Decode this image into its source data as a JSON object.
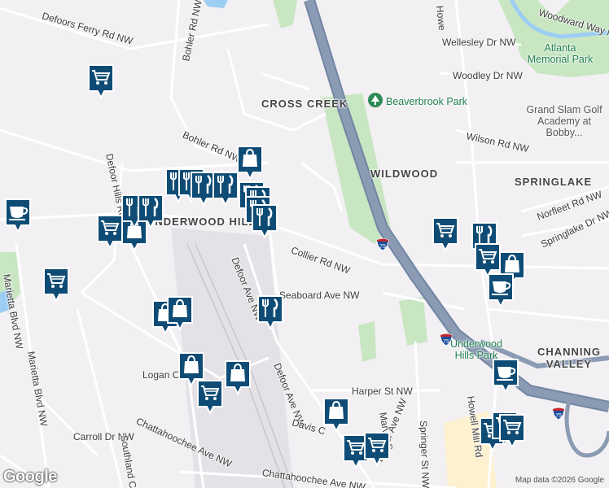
{
  "map": {
    "neighborhoods": {
      "cross_creek": "CROSS CREEK",
      "wildwood": "WILDWOOD",
      "springlake": "SPRINGLAKE",
      "underwood_hills": "UNDERWOOD HILLS",
      "channing_valley": "CHANNING VALLEY"
    },
    "roads": {
      "defoors_ferry": "Defoors Ferry Rd NW",
      "bohler_1": "Bohler Rd NW",
      "bohler_2": "Bohler Rd NW",
      "defoor_hills": "Defoor Hills Rd",
      "defoor_ave_1": "Defoor Ave NW",
      "defoor_ave_2": "Defoor Ave NW",
      "defoor_ave_3": "Defoor Ave NW",
      "collier": "Collier Rd NW",
      "seaboard": "Seaboard Ave NW",
      "marietta_1": "Marietta Blvd NW",
      "marietta_2": "Marietta Blvd NW",
      "logan": "Logan Ci",
      "carroll": "Carroll Dr NW",
      "southland": "Southland C",
      "chattahoochee_1": "Chattahoochee Ave NW",
      "chattahoochee_2": "Chattahoochee Ave NW",
      "davis": "Davis C",
      "harper": "Harper St NW",
      "marvin": "Marvin S",
      "springer": "Springer St NW",
      "howell_mill_top": "Howe",
      "howell_mill_bottom": "Howell Mill Rd",
      "woodward_way": "Woodward Way NW",
      "wellesley": "Wellesley Dr NW",
      "woodley": "Woodley Dr NW",
      "wilson": "Wilson Rd NW",
      "norfleet": "Norfleet Rd NW",
      "springlake_dr": "Springlake Dr NW"
    },
    "parks": {
      "atlanta_memorial": "Atlanta\nMemorial Park",
      "beaverbrook": "Beaverbrook Park",
      "underwood_hills_park": "Underwood\nHills Park"
    },
    "pois": {
      "grand_slam": "Grand Slam Golf\nAcademy at Bobby..."
    },
    "highway": {
      "interstate": "75"
    },
    "credit": "Map data ©2026 Google",
    "logo": "Google",
    "colors": {
      "road": "#ffffff",
      "highway": "#8b9bb4",
      "highway_edge": "#7285a3",
      "park": "#c8e6c2",
      "water": "#9ccdf3",
      "industrial": "#e4e2e6",
      "marker": "#0f4c75",
      "commercial": "#fdf1d0"
    },
    "markers": [
      {
        "kind": "cart"
      },
      {
        "kind": "coffee"
      },
      {
        "kind": "cart"
      },
      {
        "kind": "bag"
      },
      {
        "kind": "cutlery"
      },
      {
        "kind": "cutlery"
      },
      {
        "kind": "cutlery"
      },
      {
        "kind": "cutlery"
      },
      {
        "kind": "cutlery"
      },
      {
        "kind": "cutlery"
      },
      {
        "kind": "cart"
      },
      {
        "kind": "bag"
      },
      {
        "kind": "cutlery"
      },
      {
        "kind": "cutlery"
      },
      {
        "kind": "cutlery"
      },
      {
        "kind": "cutlery"
      },
      {
        "kind": "bag"
      },
      {
        "kind": "bag"
      },
      {
        "kind": "cutlery"
      },
      {
        "kind": "bag"
      },
      {
        "kind": "bag"
      },
      {
        "kind": "cart"
      },
      {
        "kind": "bag"
      },
      {
        "kind": "cart"
      },
      {
        "kind": "cart"
      },
      {
        "kind": "cart"
      },
      {
        "kind": "cutlery"
      },
      {
        "kind": "cart"
      },
      {
        "kind": "bag"
      },
      {
        "kind": "coffee"
      },
      {
        "kind": "coffee"
      },
      {
        "kind": "cart"
      },
      {
        "kind": "cart"
      },
      {
        "kind": "cart"
      }
    ]
  }
}
